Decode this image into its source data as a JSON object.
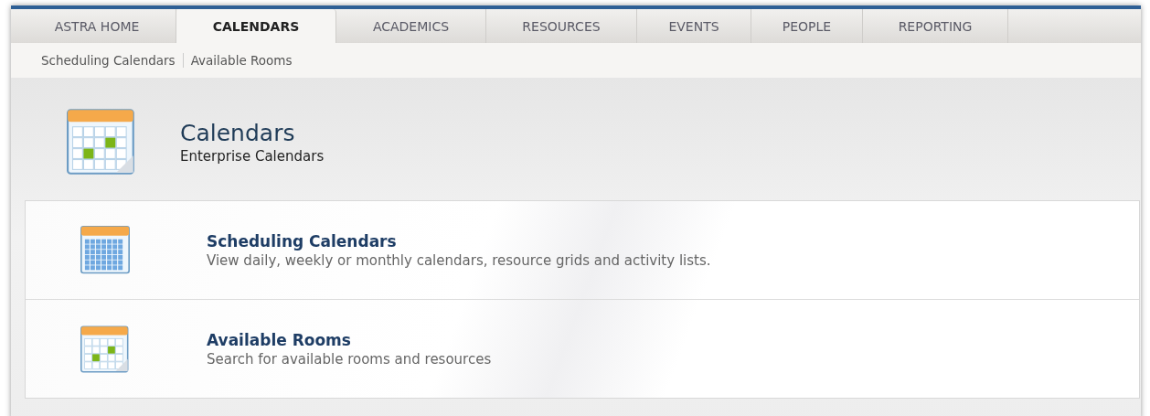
{
  "tabs": [
    {
      "label": "ASTRA HOME",
      "selected": false
    },
    {
      "label": "CALENDARS",
      "selected": true
    },
    {
      "label": "ACADEMICS",
      "selected": false
    },
    {
      "label": "RESOURCES",
      "selected": false
    },
    {
      "label": "EVENTS",
      "selected": false
    },
    {
      "label": "PEOPLE",
      "selected": false
    },
    {
      "label": "REPORTING",
      "selected": false
    }
  ],
  "subnav": [
    "Scheduling Calendars",
    "Available Rooms"
  ],
  "header": {
    "title": "Calendars",
    "subtitle": "Enterprise Calendars"
  },
  "items": [
    {
      "kind": "grid",
      "title": "Scheduling Calendars",
      "description": "View daily, weekly or monthly calendars, resource grids and activity lists."
    },
    {
      "kind": "rooms",
      "title": "Available Rooms",
      "description": "Search for available rooms and resources"
    }
  ]
}
